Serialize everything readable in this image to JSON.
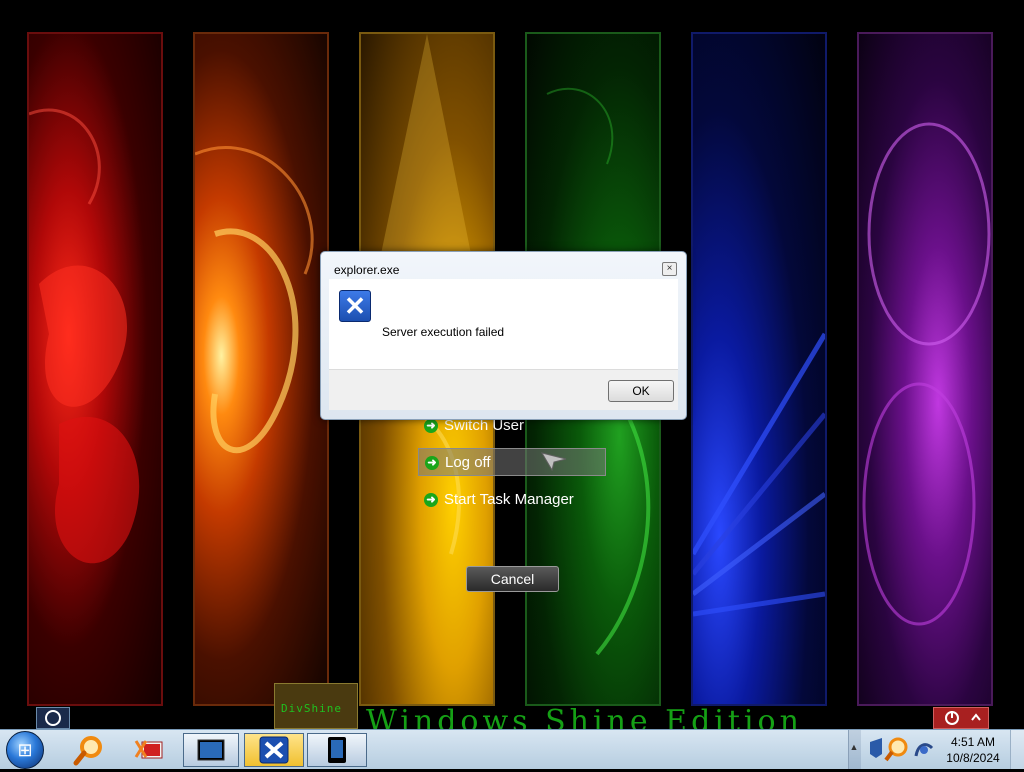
{
  "dialog": {
    "title": "explorer.exe",
    "message": "Server execution failed",
    "ok_label": "OK",
    "close_glyph": "×"
  },
  "logoff_menu": {
    "items": [
      {
        "label": "Switch User"
      },
      {
        "label": "Log off"
      },
      {
        "label": "Start Task Manager"
      }
    ],
    "cancel_label": "Cancel"
  },
  "desktop": {
    "gadget_text": "DivShine",
    "brand_text": "Windows Shine Edition"
  },
  "taskbar": {
    "time": "4:51 AM",
    "date": "10/8/2024",
    "icons": [
      "windows-start-orb",
      "search-icon",
      "media-player-icon",
      "explorer-window-icon",
      "error-window-icon",
      "tablet-icon"
    ]
  },
  "colors": {
    "menu_arrow": "#1aa61a",
    "brand_text": "#15a015",
    "taskbar": "#c8dbeb"
  }
}
